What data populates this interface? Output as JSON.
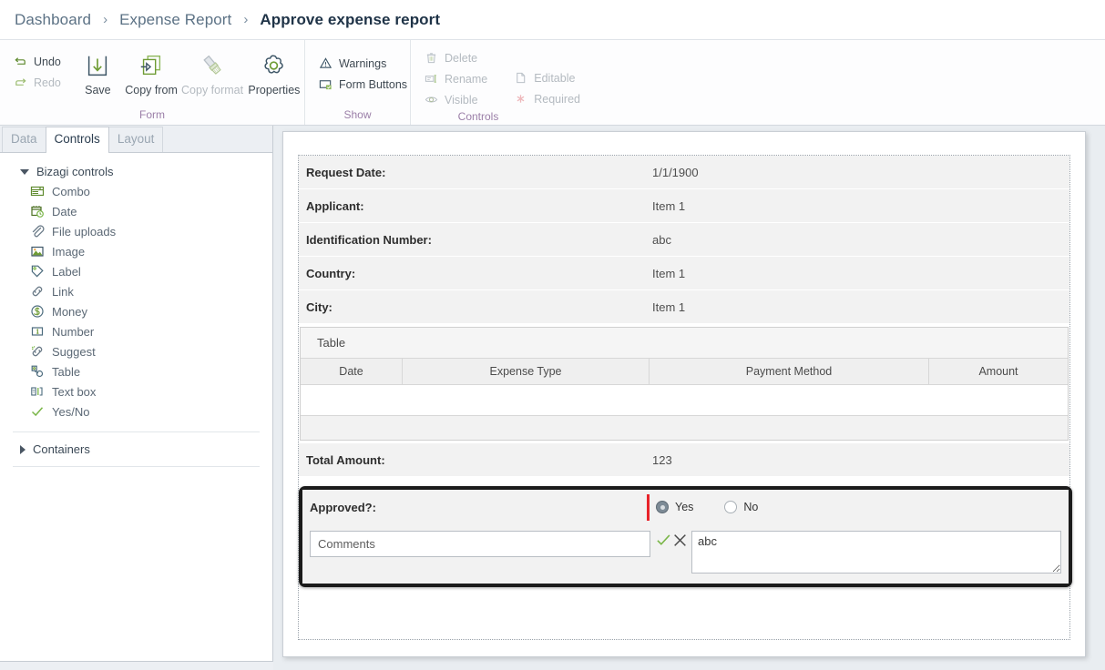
{
  "breadcrumb": {
    "separator": "›",
    "items": [
      {
        "label": "Dashboard",
        "current": false
      },
      {
        "label": "Expense Report",
        "current": false
      },
      {
        "label": "Approve expense report",
        "current": true
      }
    ]
  },
  "ribbon": {
    "groups": [
      {
        "title": "Form",
        "stack": [
          {
            "label": "Undo",
            "icon": "undo-icon",
            "disabled": false
          },
          {
            "label": "Redo",
            "icon": "redo-icon",
            "disabled": true
          }
        ],
        "buttons": [
          {
            "label": "Save",
            "icon": "save-icon",
            "disabled": false
          },
          {
            "label": "Copy from",
            "icon": "copy-from-icon",
            "disabled": false
          },
          {
            "label": "Copy format",
            "icon": "copy-format-icon",
            "disabled": true
          },
          {
            "label": "Properties",
            "icon": "gear-icon",
            "disabled": false
          }
        ]
      },
      {
        "title": "Show",
        "stack": [
          {
            "label": "Warnings",
            "icon": "warning-triangle-icon",
            "disabled": false
          },
          {
            "label": "Form Buttons",
            "icon": "form-buttons-icon",
            "disabled": false
          }
        ],
        "buttons": []
      },
      {
        "title": "Controls",
        "stack": [
          {
            "label": "Delete",
            "icon": "trash-icon",
            "disabled": true
          },
          {
            "label": "Rename",
            "icon": "rename-icon",
            "disabled": true
          },
          {
            "label": "Visible",
            "icon": "eye-icon",
            "disabled": true
          }
        ],
        "stack2": [
          {
            "label": "Editable",
            "icon": "editable-page-icon",
            "disabled": true
          },
          {
            "label": "Required",
            "icon": "required-asterisk-icon",
            "disabled": true
          }
        ],
        "buttons": []
      }
    ]
  },
  "left_panel": {
    "tabs": [
      {
        "label": "Data",
        "active": false
      },
      {
        "label": "Controls",
        "active": true
      },
      {
        "label": "Layout",
        "active": false
      }
    ],
    "groups": [
      {
        "label": "Bizagi controls",
        "expanded": true,
        "items": [
          {
            "label": "Combo",
            "icon": "combo-icon"
          },
          {
            "label": "Date",
            "icon": "date-icon"
          },
          {
            "label": "File uploads",
            "icon": "paperclip-icon"
          },
          {
            "label": "Image",
            "icon": "image-icon"
          },
          {
            "label": "Label",
            "icon": "tag-icon"
          },
          {
            "label": "Link",
            "icon": "link-icon"
          },
          {
            "label": "Money",
            "icon": "money-icon"
          },
          {
            "label": "Number",
            "icon": "number-icon"
          },
          {
            "label": "Suggest",
            "icon": "suggest-icon"
          },
          {
            "label": "Table",
            "icon": "table-icon"
          },
          {
            "label": "Text box",
            "icon": "textbox-icon"
          },
          {
            "label": "Yes/No",
            "icon": "check-icon"
          }
        ]
      },
      {
        "label": "Containers",
        "expanded": false,
        "items": []
      }
    ]
  },
  "form": {
    "fields": [
      {
        "label": "Request Date:",
        "value": "1/1/1900"
      },
      {
        "label": "Applicant:",
        "value": "Item 1"
      },
      {
        "label": "Identification Number:",
        "value": "abc"
      },
      {
        "label": "Country:",
        "value": "Item 1"
      },
      {
        "label": "City:",
        "value": "Item 1"
      }
    ],
    "table": {
      "title": "Table",
      "columns": [
        "Date",
        "Expense Type",
        "Payment Method",
        "Amount"
      ],
      "rows": []
    },
    "total": {
      "label": "Total Amount:",
      "value": "123"
    },
    "approved": {
      "label": "Approved?:",
      "options": [
        {
          "label": "Yes",
          "checked": true
        },
        {
          "label": "No",
          "checked": false
        }
      ]
    },
    "comments": {
      "input_placeholder": "Comments",
      "input_value": "",
      "textarea_value": "abc",
      "confirm_icon": "check-icon",
      "cancel_icon": "x-icon"
    }
  },
  "colors": {
    "accent_green": "#7ab648",
    "accent_blue_gray": "#5c7285",
    "group_title": "#9b7fa8",
    "highlight_border": "#1b1b1b",
    "caret_red": "#e8232a"
  }
}
